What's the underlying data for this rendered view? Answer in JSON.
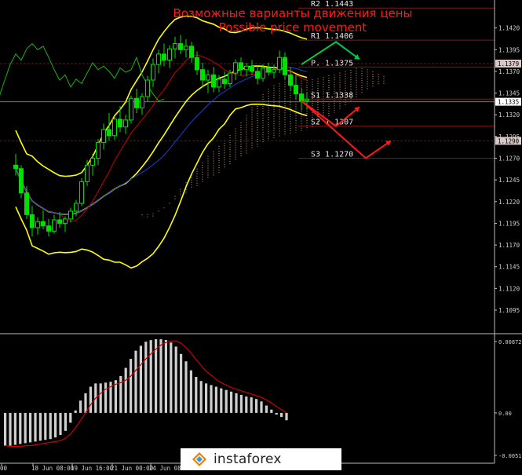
{
  "annotations": {
    "title_ru": "Возможные варианты движения цены",
    "title_en": "Possible price movement"
  },
  "watermark": "instaforex",
  "colors": {
    "background": "#000000",
    "bollinger": "#ffff00",
    "annotation": "#ff1a1a",
    "arrow_up": "#00cc44",
    "arrow_down": "#ff1a1a",
    "level_line": "#7a1a1a",
    "histogram": "#cfcfcf",
    "signal": "#cc0000",
    "kijun": "#cc0000",
    "tenkan": "#1c3fd6",
    "chikou": "#17b417",
    "cloud": "#d9a37a"
  },
  "chart_data": [
    {
      "type": "candlestick",
      "ylim": [
        1.1095,
        1.1445
      ],
      "yticks": [
        "1.1420",
        "1.1395",
        "1.1370",
        "1.1345",
        "1.1320",
        "1.1295",
        "1.1270",
        "1.1245",
        "1.1220",
        "1.1195",
        "1.1170",
        "1.1145",
        "1.1120",
        "1.1095"
      ],
      "xticks": [
        "00",
        "18 Jun 08:00",
        "19 Jun 16:00",
        "21 Jun 00:00",
        "24 Jun 08:00",
        "25 Jun"
      ],
      "price_labels": [
        {
          "value": 1.1379,
          "text": "1.1379",
          "style": "highlight"
        },
        {
          "value": 1.1335,
          "text": "1.1335",
          "style": "current"
        },
        {
          "value": 1.129,
          "text": "1.1290",
          "style": "highlight"
        }
      ],
      "levels": [
        {
          "name": "R2",
          "value": 1.1443,
          "label": "R2  1.1443"
        },
        {
          "name": "R1",
          "value": 1.1406,
          "label": "R1  1.1406"
        },
        {
          "name": "P",
          "value": 1.1375,
          "label": "P. 1.1375"
        },
        {
          "name": "S1",
          "value": 1.1338,
          "label": "S1  1.1338"
        },
        {
          "name": "S2",
          "value": 1.1307,
          "label": "S2  1.1307"
        },
        {
          "name": "S3",
          "value": 1.127,
          "label": "S3  1.1270"
        }
      ],
      "scenarios": [
        {
          "direction": "up",
          "points": [
            1.1378,
            1.1404,
            1.1384
          ]
        },
        {
          "direction": "down",
          "points": [
            1.1336,
            1.1307,
            1.1329
          ]
        },
        {
          "direction": "down",
          "points": [
            1.1336,
            1.127,
            1.129
          ]
        }
      ],
      "candles": [
        [
          1.1262,
          1.1275,
          1.125,
          1.1258
        ],
        [
          1.1258,
          1.1262,
          1.1224,
          1.123
        ],
        [
          1.123,
          1.1238,
          1.12,
          1.1205
        ],
        [
          1.1205,
          1.1215,
          1.118,
          1.119
        ],
        [
          1.119,
          1.1202,
          1.1182,
          1.1197
        ],
        [
          1.1197,
          1.121,
          1.1188,
          1.1192
        ],
        [
          1.1192,
          1.12,
          1.118,
          1.1186
        ],
        [
          1.1186,
          1.1205,
          1.1183,
          1.1199
        ],
        [
          1.1199,
          1.1208,
          1.119,
          1.1195
        ],
        [
          1.1195,
          1.1203,
          1.1185,
          1.12
        ],
        [
          1.12,
          1.1213,
          1.1196,
          1.1209
        ],
        [
          1.1209,
          1.1222,
          1.1203,
          1.1218
        ],
        [
          1.1218,
          1.1247,
          1.1215,
          1.1243
        ],
        [
          1.1243,
          1.1268,
          1.1238,
          1.1262
        ],
        [
          1.1262,
          1.1275,
          1.125,
          1.127
        ],
        [
          1.127,
          1.1292,
          1.1262,
          1.1288
        ],
        [
          1.1288,
          1.131,
          1.128,
          1.1303
        ],
        [
          1.1303,
          1.1322,
          1.129,
          1.1296
        ],
        [
          1.1296,
          1.1318,
          1.1291,
          1.1315
        ],
        [
          1.1315,
          1.133,
          1.13,
          1.1306
        ],
        [
          1.1306,
          1.132,
          1.1298,
          1.1314
        ],
        [
          1.1314,
          1.1342,
          1.131,
          1.1339
        ],
        [
          1.1339,
          1.135,
          1.1322,
          1.1328
        ],
        [
          1.1328,
          1.1345,
          1.132,
          1.1341
        ],
        [
          1.1341,
          1.1365,
          1.1335,
          1.136
        ],
        [
          1.136,
          1.1385,
          1.1352,
          1.1378
        ],
        [
          1.1378,
          1.1395,
          1.1368,
          1.139
        ],
        [
          1.139,
          1.1402,
          1.1376,
          1.1383
        ],
        [
          1.1383,
          1.14,
          1.1374,
          1.1396
        ],
        [
          1.1396,
          1.141,
          1.1385,
          1.1402
        ],
        [
          1.1402,
          1.1412,
          1.139,
          1.1395
        ],
        [
          1.1395,
          1.1407,
          1.1386,
          1.1399
        ],
        [
          1.1399,
          1.1404,
          1.138,
          1.1386
        ],
        [
          1.1386,
          1.1393,
          1.1366,
          1.1372
        ],
        [
          1.1372,
          1.138,
          1.1352,
          1.136
        ],
        [
          1.136,
          1.1372,
          1.1345,
          1.1366
        ],
        [
          1.1366,
          1.1375,
          1.1346,
          1.1352
        ],
        [
          1.1352,
          1.1366,
          1.1346,
          1.1361
        ],
        [
          1.1361,
          1.137,
          1.135,
          1.1356
        ],
        [
          1.1356,
          1.1372,
          1.1352,
          1.1368
        ],
        [
          1.1368,
          1.1384,
          1.136,
          1.138
        ],
        [
          1.138,
          1.1386,
          1.1365,
          1.1372
        ],
        [
          1.1372,
          1.138,
          1.1364,
          1.1376
        ],
        [
          1.1376,
          1.1383,
          1.1366,
          1.137
        ],
        [
          1.137,
          1.1376,
          1.1355,
          1.1362
        ],
        [
          1.1362,
          1.1378,
          1.1358,
          1.1374
        ],
        [
          1.1374,
          1.138,
          1.1365,
          1.1369
        ],
        [
          1.1369,
          1.1378,
          1.1362,
          1.1372
        ],
        [
          1.1372,
          1.1394,
          1.1368,
          1.1386
        ],
        [
          1.1386,
          1.1392,
          1.136,
          1.1366
        ],
        [
          1.1366,
          1.1375,
          1.1348,
          1.1354
        ],
        [
          1.1354,
          1.1366,
          1.1338,
          1.1344
        ],
        [
          1.1344,
          1.135,
          1.1325,
          1.1336
        ],
        [
          1.1336,
          1.1346,
          1.1326,
          1.1338
        ]
      ]
    },
    {
      "type": "bar",
      "name": "MACD",
      "ylim": [
        -0.00519,
        0.00872
      ],
      "yticks": [
        "0.00872",
        "0.00",
        "-0.00519"
      ],
      "values": [
        -0.004,
        -0.004,
        -0.0039,
        -0.0038,
        -0.0037,
        -0.0036,
        -0.0035,
        -0.0034,
        -0.0033,
        -0.0032,
        -0.003,
        -0.0027,
        -0.0022,
        -0.0012,
        0.0003,
        0.0015,
        0.0024,
        0.0032,
        0.0036,
        0.0036,
        0.0037,
        0.0038,
        0.004,
        0.0045,
        0.0055,
        0.0066,
        0.0076,
        0.0082,
        0.0087,
        0.0089,
        0.009,
        0.009,
        0.0089,
        0.0086,
        0.0081,
        0.0072,
        0.0063,
        0.0052,
        0.0044,
        0.0039,
        0.0036,
        0.0034,
        0.0032,
        0.003,
        0.0028,
        0.0026,
        0.0024,
        0.0022,
        0.002,
        0.0019,
        0.0017,
        0.0014,
        0.0009,
        0.0004,
        -0.0002,
        -0.0005,
        -0.0009
      ],
      "signal": [
        -0.004,
        -0.0041,
        -0.0041,
        -0.0041,
        -0.004,
        -0.004,
        -0.0039,
        -0.0038,
        -0.0037,
        -0.0036,
        -0.0035,
        -0.0034,
        -0.0031,
        -0.0026,
        -0.0018,
        -0.0009,
        0.0,
        0.001,
        0.0018,
        0.0024,
        0.0029,
        0.0032,
        0.0035,
        0.0037,
        0.004,
        0.0045,
        0.0052,
        0.0059,
        0.0066,
        0.0072,
        0.0078,
        0.0083,
        0.0086,
        0.0088,
        0.0088,
        0.0085,
        0.008,
        0.0073,
        0.0065,
        0.0058,
        0.0051,
        0.0046,
        0.0041,
        0.0037,
        0.0034,
        0.0031,
        0.0029,
        0.0027,
        0.0025,
        0.0023,
        0.0021,
        0.0019,
        0.0016,
        0.0012,
        0.0008,
        0.0004,
        0.0
      ]
    }
  ]
}
